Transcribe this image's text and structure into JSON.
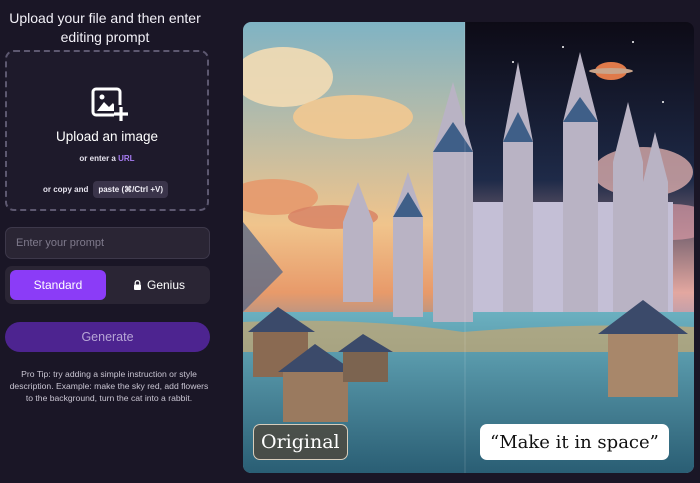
{
  "heading": "Upload your file and then enter editing prompt",
  "upload": {
    "icon": "image-plus-icon",
    "title": "Upload an image",
    "or_enter": "or enter a",
    "url_link": "URL",
    "or_copy": "or copy and",
    "paste_chip": "paste (⌘/Ctrl +V)"
  },
  "prompt": {
    "placeholder": "Enter your prompt"
  },
  "mode": {
    "standard": "Standard",
    "genius": "Genius",
    "genius_icon": "lock-icon",
    "selected": "Standard"
  },
  "generate_label": "Generate",
  "tip": "Pro Tip: try adding a simple instruction or style description. Example: make the sky red, add flowers to the background, turn the cat into a rabbit.",
  "preview": {
    "original_label": "Original",
    "edited_label": "“Make it in space”"
  },
  "colors": {
    "background": "#1a1626",
    "accent": "#8b3cf7",
    "generate_bg": "#4d2490",
    "link": "#a77cf2"
  }
}
